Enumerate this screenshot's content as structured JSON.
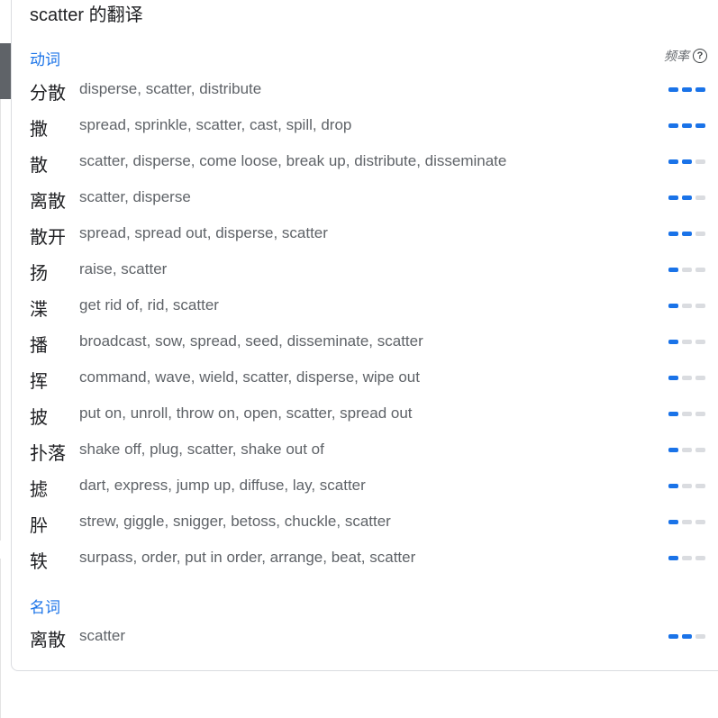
{
  "header": {
    "title": "scatter 的翻译",
    "frequency_label": "频率",
    "help_icon": "help-icon"
  },
  "sections": [
    {
      "pos": "动词",
      "rows": [
        {
          "word": "分散",
          "translations": "disperse, scatter, distribute",
          "frequency": 3
        },
        {
          "word": "撒",
          "translations": "spread, sprinkle, scatter, cast, spill, drop",
          "frequency": 3
        },
        {
          "word": "散",
          "translations": "scatter, disperse, come loose, break up, distribute, disseminate",
          "frequency": 2
        },
        {
          "word": "离散",
          "translations": "scatter, disperse",
          "frequency": 2
        },
        {
          "word": "散开",
          "translations": "spread, spread out, disperse, scatter",
          "frequency": 2
        },
        {
          "word": "扬",
          "translations": "raise, scatter",
          "frequency": 1
        },
        {
          "word": "渫",
          "translations": "get rid of, rid, scatter",
          "frequency": 1
        },
        {
          "word": "播",
          "translations": "broadcast, sow, spread, seed, disseminate, scatter",
          "frequency": 1
        },
        {
          "word": "挥",
          "translations": "command, wave, wield, scatter, disperse, wipe out",
          "frequency": 1
        },
        {
          "word": "披",
          "translations": "put on, unroll, throw on, open, scatter, spread out",
          "frequency": 1
        },
        {
          "word": "扑落",
          "translations": "shake off, plug, scatter, shake out of",
          "frequency": 1
        },
        {
          "word": "摅",
          "translations": "dart, express, jump up, diffuse, lay, scatter",
          "frequency": 1
        },
        {
          "word": "肸",
          "translations": "strew, giggle, snigger, betoss, chuckle, scatter",
          "frequency": 1
        },
        {
          "word": "轶",
          "translations": "surpass, order, put in order, arrange, beat, scatter",
          "frequency": 1
        }
      ]
    },
    {
      "pos": "名词",
      "rows": [
        {
          "word": "离散",
          "translations": "scatter",
          "frequency": 2
        }
      ]
    }
  ],
  "colors": {
    "accent": "#1a73e8",
    "bar_off": "#dadce0",
    "text": "#202124",
    "muted": "#5f6368"
  }
}
